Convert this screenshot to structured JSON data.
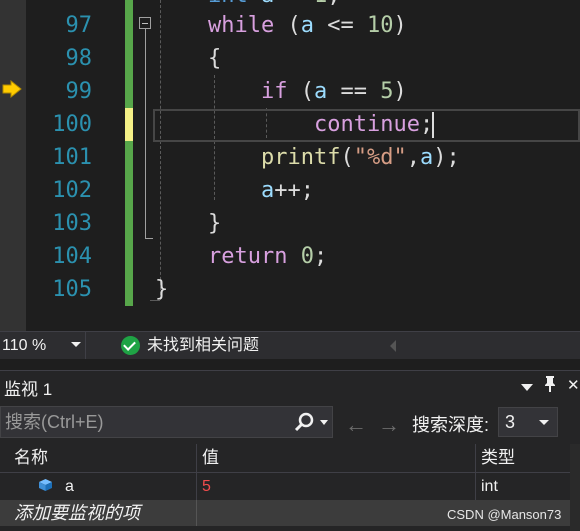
{
  "editor": {
    "line_numbers": [
      "97",
      "98",
      "99",
      "100",
      "101",
      "102",
      "103",
      "104",
      "105"
    ],
    "code": {
      "l97_kw": "while",
      "l97_open": " (",
      "l97_var": "a",
      "l97_op": " <= ",
      "l97_num": "10",
      "l97_close": ")",
      "l98": "{",
      "l99_kw": "if",
      "l99_open": " (",
      "l99_var": "a",
      "l99_op": " == ",
      "l99_num": "5",
      "l99_close": ")",
      "l100_kw": "continue",
      "l100_semi": ";",
      "l101_fn": "printf",
      "l101_open": "(",
      "l101_str": "\"%d\"",
      "l101_comma": ",",
      "l101_var": "a",
      "l101_close": ");",
      "l102_var": "a",
      "l102_rest": "++;",
      "l103": "}",
      "l104_kw": "return",
      "l104_sp": " ",
      "l104_num": "0",
      "l104_semi": ";",
      "l105": "}"
    }
  },
  "status": {
    "zoom": "110 %",
    "issues": "未找到相关问题"
  },
  "watch": {
    "title": "监视 1",
    "pin": "📌",
    "close": "✕",
    "search_placeholder": "搜索(Ctrl+E)",
    "back_arrow": "←",
    "forward_arrow": "→",
    "depth_label": "搜索深度:",
    "depth_value": "3",
    "columns": [
      "名称",
      "值",
      "类型"
    ],
    "rows": [
      {
        "name": "a",
        "value": "5",
        "type": "int"
      }
    ],
    "add_item": "添加要监视的项"
  },
  "watermark": "CSDN @Manson73",
  "colors": {
    "line_number": "#2b91af",
    "keyword_control": "#d8a0df",
    "keyword_builtin": "#569cd6",
    "variable": "#9cdcfe",
    "number": "#b5cea8",
    "string": "#d69d85",
    "function": "#dcdcaa",
    "changed_saved": "#57a64a",
    "changed_unsaved": "#f4f086",
    "value_changed": "#f14c4c",
    "exec_arrow": "#ffcc00"
  }
}
